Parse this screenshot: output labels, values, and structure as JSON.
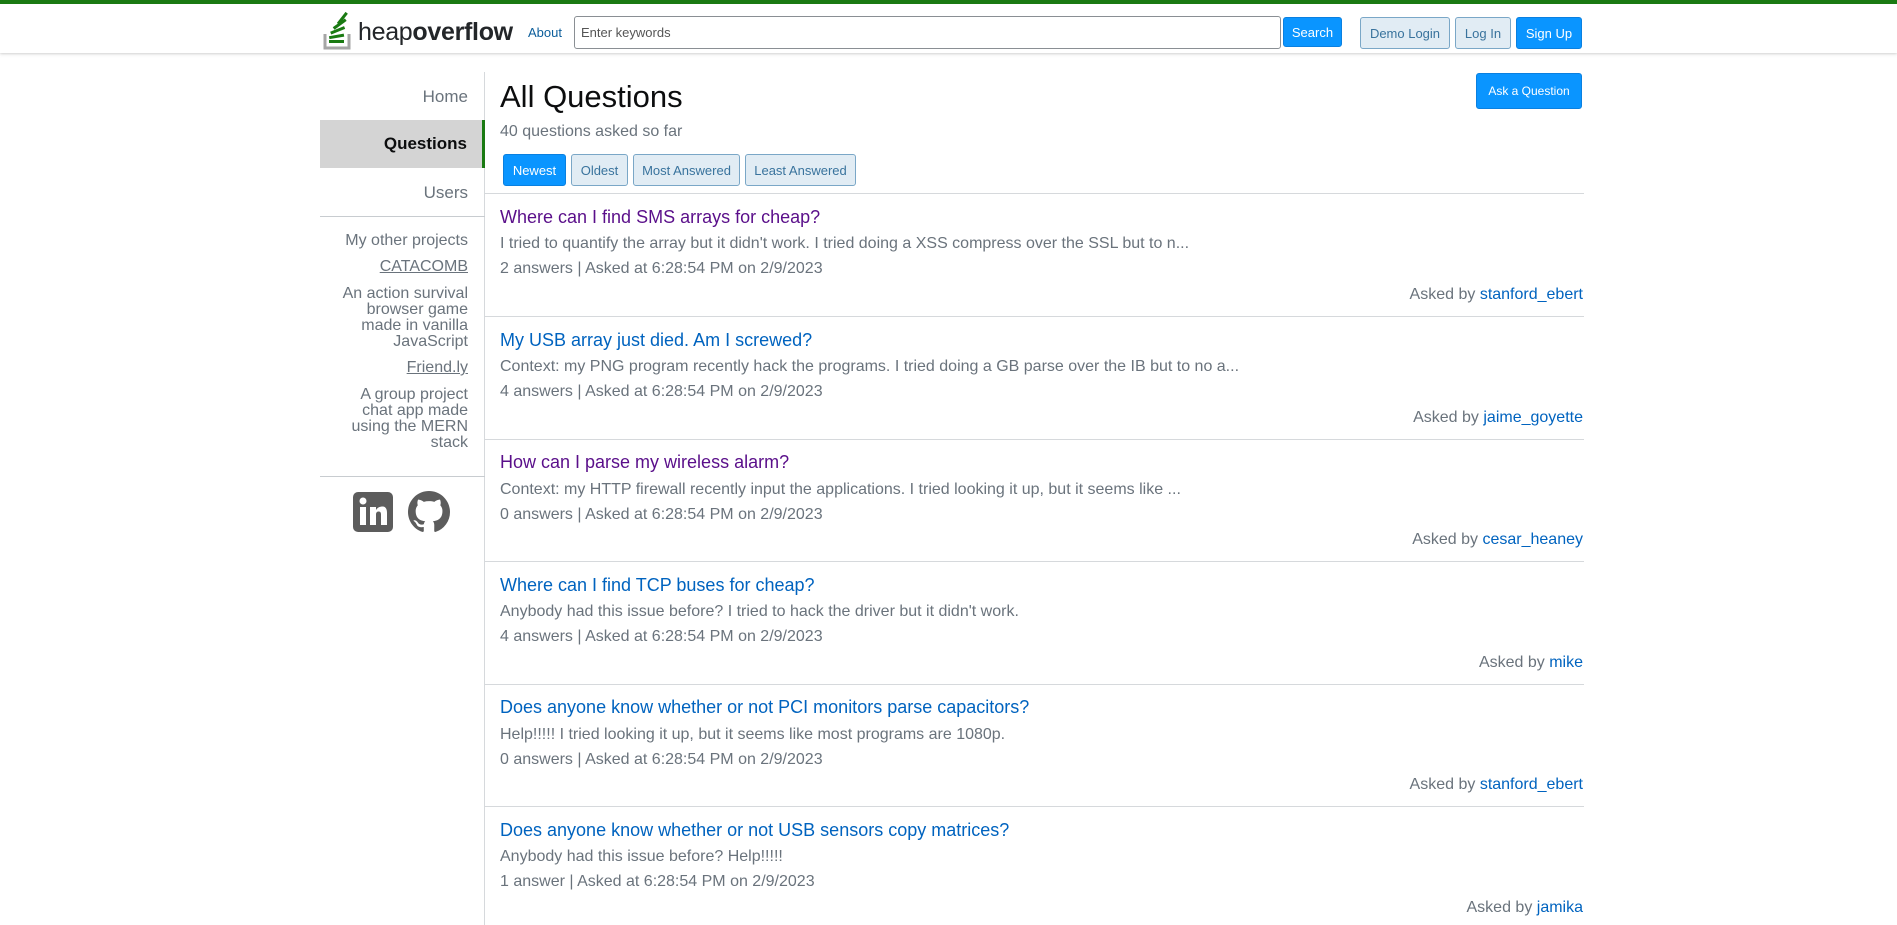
{
  "header": {
    "logo_light": "heap",
    "logo_bold": "overflow",
    "about": "About",
    "search_placeholder": "Enter keywords",
    "search_button": "Search",
    "demo_login": "Demo Login",
    "log_in": "Log In",
    "sign_up": "Sign Up"
  },
  "sidebar": {
    "home": "Home",
    "questions": "Questions",
    "users": "Users",
    "projects_heading": "My other projects",
    "projects": [
      {
        "name": "CATACOMB",
        "lines": [
          "An action survival",
          "browser game",
          "made in vanilla",
          "JavaScript"
        ]
      },
      {
        "name": "Friend.ly",
        "lines": [
          "A group project",
          "chat app made",
          "using the MERN",
          "stack"
        ]
      }
    ],
    "social_icons": [
      "linkedin-icon",
      "github-icon"
    ]
  },
  "main": {
    "title": "All Questions",
    "count_text": "40 questions asked so far",
    "ask_button": "Ask a Question",
    "sort_tabs": [
      "Newest",
      "Oldest",
      "Most Answered",
      "Least Answered"
    ],
    "active_tab": "Newest",
    "asked_by_label": "Asked by",
    "questions": [
      {
        "title": "Where can I find SMS arrays for cheap?",
        "excerpt": "I tried to quantify the array but it didn't work. I tried doing a XSS compress over the SSL but to n...",
        "meta": "2 answers | Asked at 6:28:54 PM on 2/9/2023",
        "user": "stanford_ebert",
        "visited": true
      },
      {
        "title": "My USB array just died. Am I screwed?",
        "excerpt": "Context: my PNG program recently hack the programs. I tried doing a GB parse over the IB but to no a...",
        "meta": "4 answers | Asked at 6:28:54 PM on 2/9/2023",
        "user": "jaime_goyette",
        "visited": false
      },
      {
        "title": "How can I parse my wireless alarm?",
        "excerpt": "Context: my HTTP firewall recently input the applications. I tried looking it up, but it seems like ...",
        "meta": "0 answers | Asked at 6:28:54 PM on 2/9/2023",
        "user": "cesar_heaney",
        "visited": true
      },
      {
        "title": "Where can I find TCP buses for cheap?",
        "excerpt": "Anybody had this issue before? I tried to hack the driver but it didn't work.",
        "meta": "4 answers | Asked at 6:28:54 PM on 2/9/2023",
        "user": "mike",
        "visited": false
      },
      {
        "title": "Does anyone know whether or not PCI monitors parse capacitors?",
        "excerpt": "Help!!!!! I tried looking it up, but it seems like most programs are 1080p.",
        "meta": "0 answers | Asked at 6:28:54 PM on 2/9/2023",
        "user": "stanford_ebert",
        "visited": false
      },
      {
        "title": "Does anyone know whether or not USB sensors copy matrices?",
        "excerpt": "Anybody had this issue before? Help!!!!!",
        "meta": "1 answer | Asked at 6:28:54 PM on 2/9/2023",
        "user": "jamika",
        "visited": false
      }
    ]
  },
  "colors": {
    "brand_green": "#1a7a12",
    "accent_blue": "#0a95ff",
    "link_blue": "#0063bf",
    "visited_purple": "#5a0f8a"
  }
}
